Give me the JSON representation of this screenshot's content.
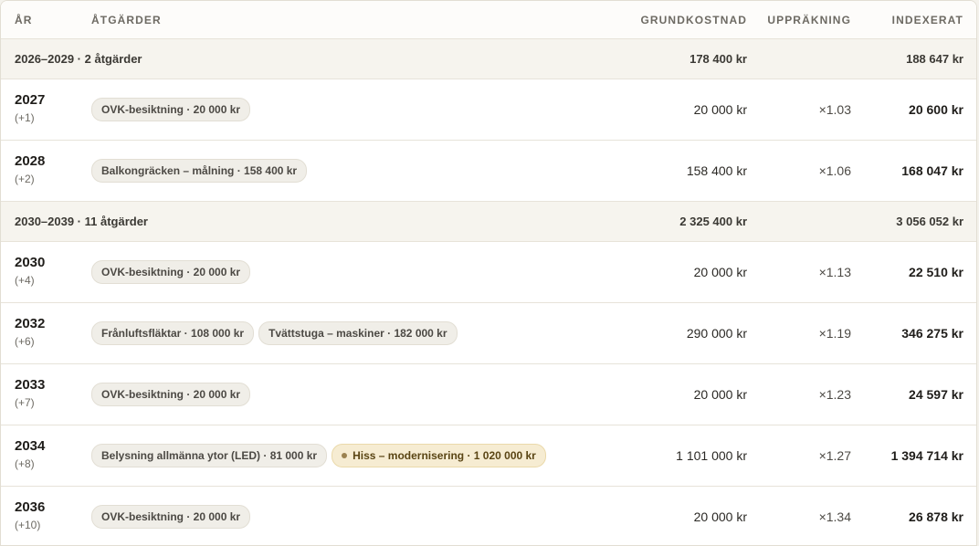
{
  "header": {
    "year": "ÅR",
    "actions": "ÅTGÄRDER",
    "base": "GRUNDKOSTNAD",
    "factor": "UPPRÄKNING",
    "indexed": "INDEXERAT"
  },
  "groups": [
    {
      "label": "2026–2029 · 2 åtgärder",
      "base": "178 400 kr",
      "indexed": "188 647 kr",
      "rows": [
        {
          "year": "2027",
          "offset": "(+1)",
          "chips": [
            {
              "label": "OVK-besiktning · 20 000 kr",
              "highlight": false
            }
          ],
          "base": "20 000 kr",
          "factor": "×1.03",
          "indexed": "20 600 kr"
        },
        {
          "year": "2028",
          "offset": "(+2)",
          "chips": [
            {
              "label": "Balkongräcken – målning · 158 400 kr",
              "highlight": false
            }
          ],
          "base": "158 400 kr",
          "factor": "×1.06",
          "indexed": "168 047 kr"
        }
      ]
    },
    {
      "label": "2030–2039 · 11 åtgärder",
      "base": "2 325 400 kr",
      "indexed": "3 056 052 kr",
      "rows": [
        {
          "year": "2030",
          "offset": "(+4)",
          "chips": [
            {
              "label": "OVK-besiktning · 20 000 kr",
              "highlight": false
            }
          ],
          "base": "20 000 kr",
          "factor": "×1.13",
          "indexed": "22 510 kr"
        },
        {
          "year": "2032",
          "offset": "(+6)",
          "chips": [
            {
              "label": "Frånluftsfläktar · 108 000 kr",
              "highlight": false
            },
            {
              "label": "Tvättstuga – maskiner · 182 000 kr",
              "highlight": false
            }
          ],
          "base": "290 000 kr",
          "factor": "×1.19",
          "indexed": "346 275 kr"
        },
        {
          "year": "2033",
          "offset": "(+7)",
          "chips": [
            {
              "label": "OVK-besiktning · 20 000 kr",
              "highlight": false
            }
          ],
          "base": "20 000 kr",
          "factor": "×1.23",
          "indexed": "24 597 kr"
        },
        {
          "year": "2034",
          "offset": "(+8)",
          "chips": [
            {
              "label": "Belysning allmänna ytor (LED) · 81 000 kr",
              "highlight": false
            },
            {
              "label": "Hiss – modernisering · 1 020 000 kr",
              "highlight": true
            }
          ],
          "base": "1 101 000 kr",
          "factor": "×1.27",
          "indexed": "1 394 714 kr"
        },
        {
          "year": "2036",
          "offset": "(+10)",
          "chips": [
            {
              "label": "OVK-besiktning · 20 000 kr",
              "highlight": false
            }
          ],
          "base": "20 000 kr",
          "factor": "×1.34",
          "indexed": "26 878 kr"
        }
      ]
    }
  ],
  "colors": {
    "group_bg": "#f6f4ee",
    "chip_bg": "#f0eee8",
    "chip_highlight_bg": "#f6ecd2",
    "chip_highlight_dot": "#9b8250"
  }
}
